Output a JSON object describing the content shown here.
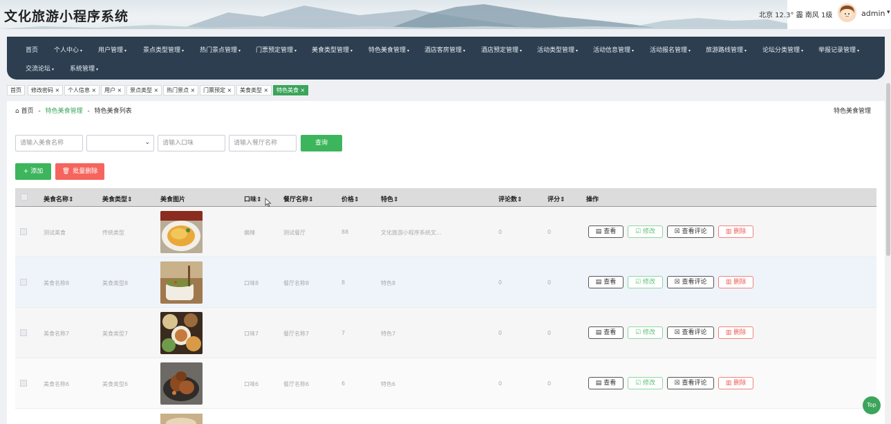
{
  "app": {
    "title": "文化旅游小程序系统"
  },
  "weather": {
    "text": "北京 12.3° 霾 南风 1级"
  },
  "user": {
    "name": "admin",
    "caret": "▾"
  },
  "nav": {
    "row1": [
      "首页",
      "个人中心",
      "用户管理",
      "景点类型管理",
      "热门景点管理",
      "门票预定管理",
      "美食类型管理",
      "特色美食管理",
      "酒店客房管理",
      "酒店预定管理",
      "活动类型管理",
      "活动信息管理",
      "活动报名管理",
      "旅游路线管理",
      "论坛分类管理",
      "举报记录管理"
    ],
    "row2": [
      "交流论坛",
      "系统管理"
    ],
    "caret": "▾"
  },
  "tags": [
    "首页",
    "修改密码 ×",
    "个人信息 ×",
    "用户 ×",
    "景点类型 ×",
    "热门景点 ×",
    "门票预定 ×",
    "美食类型 ×",
    "特色美食 ×"
  ],
  "breadcrumb": {
    "home": "首页",
    "sep": "-",
    "section": "特色美食管理",
    "page": "特色美食列表",
    "right": "特色美食管理"
  },
  "search": {
    "name_placeholder": "请输入美食名称",
    "taste_placeholder": "请输入口味",
    "restaurant_placeholder": "请输入餐厅名称",
    "query_label": "查询"
  },
  "actions": {
    "add_label": "+ 添加",
    "batch_delete_label": "批量删除"
  },
  "table": {
    "headers": [
      "美食名称",
      "美食类型",
      "美食图片",
      "口味",
      "餐厅名称",
      "价格",
      "特色",
      "评论数",
      "评分",
      "操作"
    ],
    "rows": [
      {
        "name": "测试美食",
        "type": "传统类型",
        "taste": "偏辣",
        "restaurant": "测试餐厅",
        "price": "88",
        "feature": "文化旅游小程序系统文...",
        "comments": "0",
        "score": "0"
      },
      {
        "name": "美食名称8",
        "type": "美食类型8",
        "taste": "口味8",
        "restaurant": "餐厅名称8",
        "price": "8",
        "feature": "特色8",
        "comments": "0",
        "score": "0"
      },
      {
        "name": "美食名称7",
        "type": "美食类型7",
        "taste": "口味7",
        "restaurant": "餐厅名称7",
        "price": "7",
        "feature": "特色7",
        "comments": "0",
        "score": "0"
      },
      {
        "name": "美食名称6",
        "type": "美食类型6",
        "taste": "口味6",
        "restaurant": "餐厅名称6",
        "price": "6",
        "feature": "特色6",
        "comments": "0",
        "score": "0"
      }
    ],
    "row_actions": {
      "view": "查看",
      "edit": "修改",
      "comments": "查看评论",
      "delete": "删除"
    }
  },
  "top_button": "Top",
  "colors": {
    "nav_bg": "#2c3e50",
    "accent_green": "#3ca55c",
    "danger": "#f5655d"
  }
}
